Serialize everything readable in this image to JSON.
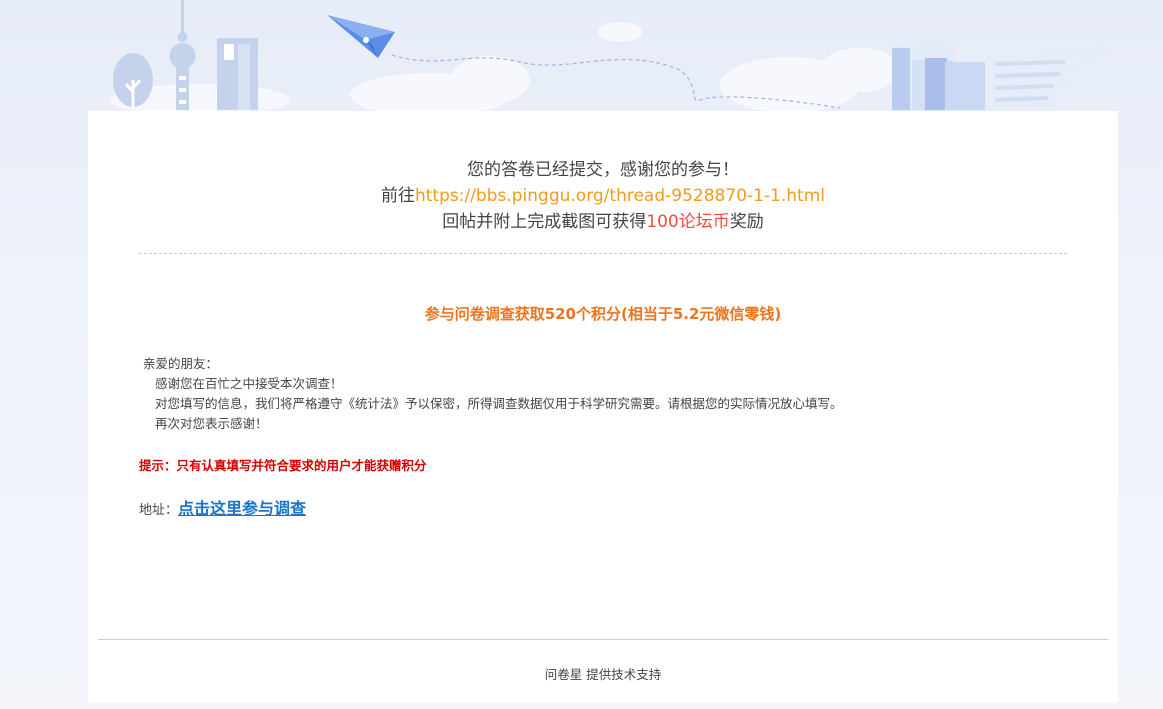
{
  "banner": {
    "icons": [
      "tree-icon",
      "tv-tower-icon",
      "skyscraper-icon",
      "paper-plane-icon",
      "books-icon",
      "scroll-paper-icon"
    ]
  },
  "thanks": {
    "line1": "您的答卷已经提交，感谢您的参与！",
    "line2_prefix": "前往",
    "line2_link": "https://bbs.pinggu.org/thread-9528870-1-1.html",
    "line3_prefix": "回帖并附上完成截图可获得",
    "line3_reward": "100论坛币",
    "line3_suffix": "奖励"
  },
  "headline": "参与问卷调查获取520个积分(相当于5.2元微信零钱)",
  "letter": {
    "greeting": "亲爱的朋友：",
    "line1": "感谢您在百忙之中接受本次调查！",
    "line2": "对您填写的信息，我们将严格遵守《统计法》予以保密，所得调查数据仅用于科学研究需要。请根据您的实际情况放心填写。",
    "line3": "再次对您表示感谢！"
  },
  "tip": "提示：只有认真填写并符合要求的用户才能获赠积分",
  "address": {
    "label": "地址：",
    "link": "点击这里参与调查"
  },
  "footer": "问卷星 提供技术支持",
  "colors": {
    "link_orange": "#f39a1e",
    "reward_red": "#f24c3d",
    "headline_orange": "#f0731d",
    "tip_red": "#d60000",
    "survey_link_blue": "#1a74c9"
  }
}
